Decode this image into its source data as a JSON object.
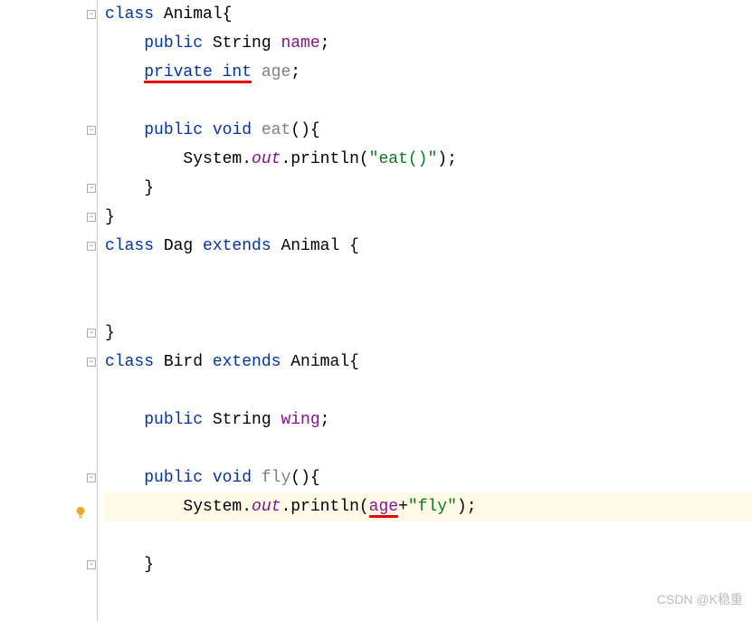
{
  "language": "java",
  "code": {
    "l1": {
      "t1": "class",
      "t2": " Animal{"
    },
    "l2": {
      "t1": "public",
      "t2": " String ",
      "t3": "name",
      "t4": ";"
    },
    "l3": {
      "t1": "private int",
      "t2": " ",
      "t3": "age",
      "t4": ";"
    },
    "l4": "",
    "l5": {
      "t1": "public",
      "t2": " ",
      "t3": "void",
      "t4": " ",
      "t5": "eat",
      "t6": "(){"
    },
    "l6": {
      "t1": "System.",
      "t2": "out",
      "t3": ".println(",
      "t4": "\"eat()\"",
      "t5": ");"
    },
    "l7": "}",
    "l8": "}",
    "l9": {
      "t1": "class",
      "t2": " Dag ",
      "t3": "extends",
      "t4": " Animal {"
    },
    "l10": "",
    "l11": "",
    "l12": "}",
    "l13": {
      "t1": "class",
      "t2": " Bird ",
      "t3": "extends",
      "t4": " Animal{"
    },
    "l14": "",
    "l15": {
      "t1": "public",
      "t2": " String ",
      "t3": "wing",
      "t4": ";"
    },
    "l16": "",
    "l17": {
      "t1": "public",
      "t2": " ",
      "t3": "void",
      "t4": " ",
      "t5": "fly",
      "t6": "(){"
    },
    "l18": {
      "t1": "System.",
      "t2": "out",
      "t3": ".println(",
      "t4": "age",
      "t5": "+",
      "t6": "\"fly\"",
      "t7": ");"
    },
    "l19": "",
    "l20": "}"
  },
  "watermark": "CSDN @K稳重",
  "colors": {
    "keyword": "#0033b3",
    "field": "#871094",
    "string": "#067d17",
    "unused": "#808080",
    "error": "#e60000",
    "bulb": "#f5a623"
  }
}
